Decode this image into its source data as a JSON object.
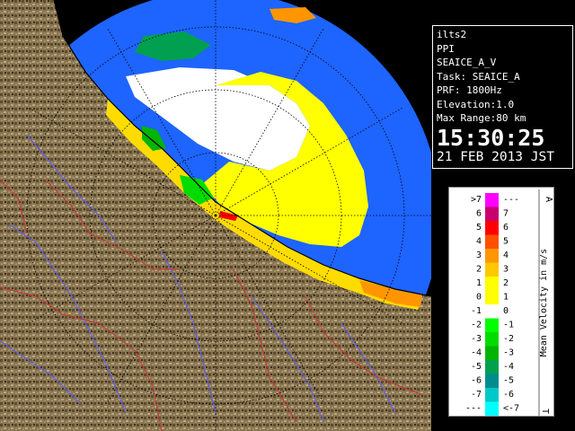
{
  "header": {
    "station": "ilts2",
    "mode": "PPI",
    "product": "SEAICE_A_V",
    "task": "Task: SEAICE_A",
    "prf": "PRF: 1800Hz",
    "elevation": "Elevation:1.0",
    "max_range": "Max Range:80 km",
    "time": "15:30:25",
    "date": "21 FEB 2013 JST"
  },
  "legend": {
    "title": "Mean Velocity in m/s",
    "top_marker": "A",
    "bottom_marker": "T",
    "bins": [
      {
        "left": ">7",
        "right": "---",
        "color": "#ff00ff"
      },
      {
        "left": "6",
        "right": "7",
        "color": "#c8006e"
      },
      {
        "left": "5",
        "right": "6",
        "color": "#ff0000"
      },
      {
        "left": "4",
        "right": "5",
        "color": "#ff5000"
      },
      {
        "left": "3",
        "right": "4",
        "color": "#ff9600"
      },
      {
        "left": "2",
        "right": "3",
        "color": "#ffc800"
      },
      {
        "left": "1",
        "right": "2",
        "color": "#ffff00"
      },
      {
        "left": "0",
        "right": "1",
        "color": "#ffff00"
      },
      {
        "left": "-1",
        "right": "0",
        "color": "#ffffff"
      },
      {
        "left": "-2",
        "right": "-1",
        "color": "#00ff00"
      },
      {
        "left": "-3",
        "right": "-2",
        "color": "#00dc00"
      },
      {
        "left": "-4",
        "right": "-3",
        "color": "#00b400"
      },
      {
        "left": "-5",
        "right": "-4",
        "color": "#00a050"
      },
      {
        "left": "-6",
        "right": "-5",
        "color": "#008c8c"
      },
      {
        "left": "-7",
        "right": "-6",
        "color": "#00c8c8"
      },
      {
        "left": "---",
        "right": "<-7",
        "color": "#00ffff"
      }
    ]
  },
  "colors": {
    "sea": "#1e64ff",
    "land": "#8a7650",
    "rings": "#000000"
  }
}
